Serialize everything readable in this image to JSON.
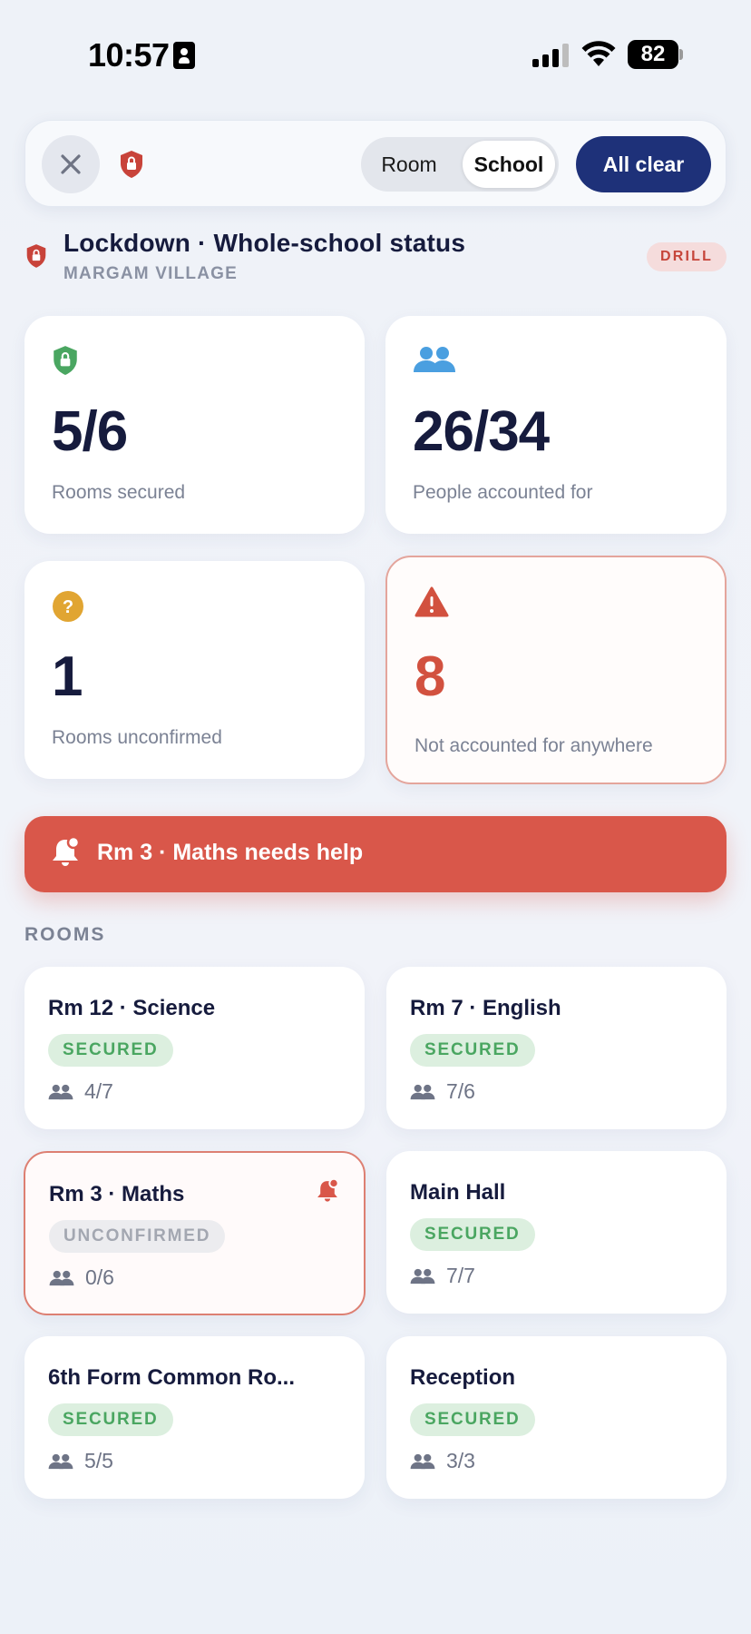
{
  "status_bar": {
    "time": "10:57",
    "battery": "82"
  },
  "toolbar": {
    "segments": [
      "Room",
      "School"
    ],
    "selected_segment": "School",
    "all_clear_label": "All clear"
  },
  "header": {
    "title": "Lockdown · Whole-school status",
    "subtitle": "MARGAM VILLAGE",
    "badge": "DRILL"
  },
  "stats": [
    {
      "value": "5/6",
      "label": "Rooms secured",
      "icon": "shield-lock-icon",
      "color": "#4aa661"
    },
    {
      "value": "26/34",
      "label": "People accounted for",
      "icon": "people-icon",
      "color": "#4a9fe0"
    },
    {
      "value": "1",
      "label": "Rooms unconfirmed",
      "icon": "question-icon",
      "color": "#e1a532"
    },
    {
      "value": "8",
      "label": "Not accounted for anywhere",
      "icon": "warning-icon",
      "color": "#d2513f"
    }
  ],
  "help_banner": {
    "text": "Rm 3 · Maths needs help",
    "icon": "bell-alert-icon"
  },
  "rooms_heading": "ROOMS",
  "rooms": [
    {
      "name": "Rm 12 · Science",
      "status": "SECURED",
      "count": "4/7"
    },
    {
      "name": "Rm 7 · English",
      "status": "SECURED",
      "count": "7/6"
    },
    {
      "name": "Rm 3 · Maths",
      "status": "UNCONFIRMED",
      "count": "0/6"
    },
    {
      "name": "Main Hall",
      "status": "SECURED",
      "count": "7/7"
    },
    {
      "name": "6th Form Common Ro...",
      "status": "SECURED",
      "count": "5/5"
    },
    {
      "name": "Reception",
      "status": "SECURED",
      "count": "3/3"
    }
  ],
  "colors": {
    "primary": "#1e3179",
    "alert": "#d9574a",
    "secured": "#4aa661",
    "text": "#161b3d",
    "muted": "#7b8294"
  }
}
